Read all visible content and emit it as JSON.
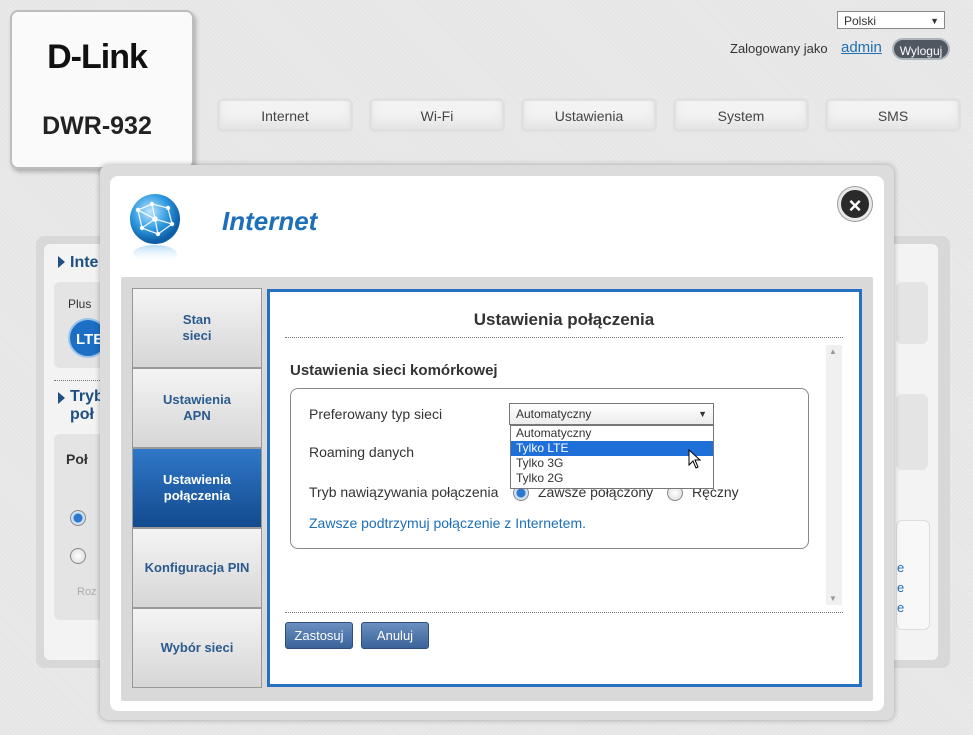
{
  "header": {
    "brand": "D-Link",
    "model": "DWR-932",
    "language": "Polski",
    "logged_in_label": "Zalogowany jako",
    "username": "admin",
    "logout_label": "Wyloguj"
  },
  "nav": {
    "tabs": [
      "Internet",
      "Wi-Fi",
      "Ustawienia",
      "System",
      "SMS"
    ]
  },
  "background": {
    "section1": "Inte",
    "plus": "Plus",
    "lte_badge": "LTE",
    "section2_line1": "Tryb",
    "section2_line2": "poł",
    "label_pol": "Poł",
    "label_roz": "Roz",
    "right_letters": [
      "e",
      "e",
      "e"
    ]
  },
  "modal": {
    "title": "Internet",
    "close_label": "×",
    "sidebar": [
      {
        "line1": "Stan",
        "line2": "sieci",
        "active": false
      },
      {
        "line1": "Ustawienia",
        "line2": "APN",
        "active": false
      },
      {
        "line1": "Ustawienia",
        "line2": "połączenia",
        "active": true
      },
      {
        "line1": "Konfiguracja PIN",
        "line2": "",
        "active": false
      },
      {
        "line1": "Wybór sieci",
        "line2": "",
        "active": false
      }
    ],
    "content_title": "Ustawienia połączenia",
    "section_title": "Ustawienia sieci komórkowej",
    "network_type_label": "Preferowany typ sieci",
    "network_type_value": "Automatyczny",
    "network_type_options": [
      "Automatyczny",
      "Tylko LTE",
      "Tylko 3G",
      "Tylko 2G"
    ],
    "network_type_highlighted": "Tylko LTE",
    "roaming_label": "Roaming danych",
    "connection_mode_label": "Tryb nawiązywania połączenia",
    "mode_always": "Zawsze połączony",
    "mode_manual": "Ręczny",
    "keepalive_text": "Zawsze podtrzymuj połączenie z Internetem.",
    "apply_label": "Zastosuj",
    "cancel_label": "Anuluj"
  },
  "colors": {
    "accent": "#1d6fb8",
    "active_tab": "#1a5aa5",
    "highlight": "#1e6fd8"
  },
  "icons": {
    "modal_icon": "globe-network-icon",
    "close": "close-icon",
    "cursor": "mouse-pointer-icon"
  }
}
